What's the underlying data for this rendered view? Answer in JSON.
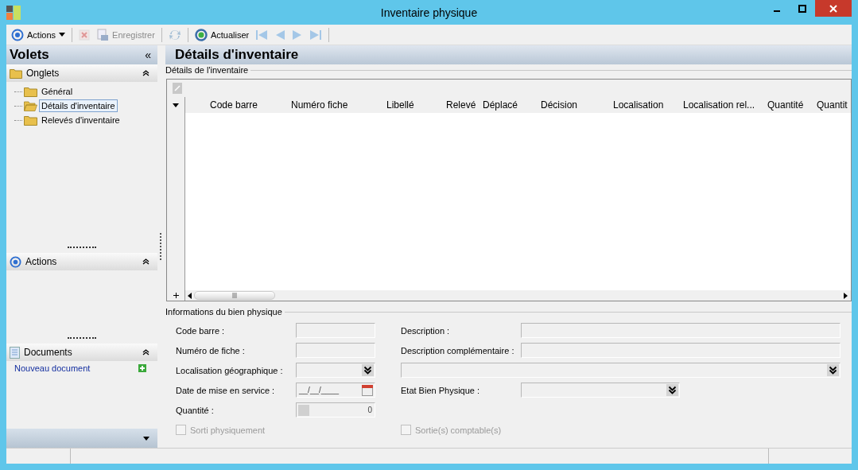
{
  "window": {
    "title": "Inventaire physique"
  },
  "toolbar": [
    {
      "kind": "menu",
      "label": "Actions",
      "disabled": false
    },
    {
      "kind": "sep"
    },
    {
      "kind": "delete",
      "disabled": true
    },
    {
      "kind": "save",
      "label": "Enregistrer",
      "disabled": true
    },
    {
      "kind": "sep"
    },
    {
      "kind": "sync",
      "disabled": true
    },
    {
      "kind": "sep"
    },
    {
      "kind": "refresh",
      "label": "Actualiser",
      "disabled": false
    },
    {
      "kind": "first",
      "disabled": true
    },
    {
      "kind": "prev",
      "disabled": true
    },
    {
      "kind": "next",
      "disabled": true
    },
    {
      "kind": "last",
      "disabled": true
    },
    {
      "kind": "sep"
    }
  ],
  "panes": {
    "title": "Volets",
    "collapse": "«",
    "sections": [
      {
        "title": "Onglets",
        "expanded": true,
        "items": [
          {
            "label": "Général",
            "selected": false
          },
          {
            "label": "Détails d'inventaire",
            "selected": true
          },
          {
            "label": "Relevés d'inventaire",
            "selected": false
          }
        ]
      },
      {
        "title": "Actions",
        "expanded": true
      },
      {
        "title": "Documents",
        "expanded": true,
        "link": "Nouveau document"
      }
    ]
  },
  "main": {
    "title": "Détails d'inventaire",
    "grid_group": "Détails de l'inventaire",
    "columns": [
      "Code barre",
      "Numéro fiche",
      "Libellé",
      "Relevé",
      "Déplacé",
      "Décision",
      "Localisation",
      "Localisation rel...",
      "Quantité",
      "Quantit"
    ],
    "form_group": "Informations du bien physique",
    "rows": [
      {
        "left": {
          "kind": "text",
          "label": "Code barre :"
        },
        "right": {
          "kind": "text",
          "label": "Description :"
        }
      },
      {
        "left": {
          "kind": "text",
          "label": "Numéro de fiche :"
        },
        "right": {
          "kind": "text",
          "label": "Description complémentaire :"
        }
      },
      {
        "left": {
          "kind": "combo",
          "label": "Localisation géographique :"
        },
        "right": {
          "kind": "wide-combo"
        }
      },
      {
        "left": {
          "kind": "date",
          "label": "Date de mise en service :",
          "value": "__/__/____"
        },
        "right": {
          "kind": "combo",
          "label": "Etat Bien Physique :"
        }
      },
      {
        "left": {
          "kind": "spin",
          "label": "Quantité :",
          "value": "0"
        }
      },
      {
        "left": {
          "kind": "checkbox",
          "label": "Sorti physiquement",
          "checked": false,
          "disabled": true
        },
        "right": {
          "kind": "checkbox",
          "label": "Sortie(s) comptable(s)",
          "checked": false,
          "disabled": true
        }
      }
    ]
  }
}
